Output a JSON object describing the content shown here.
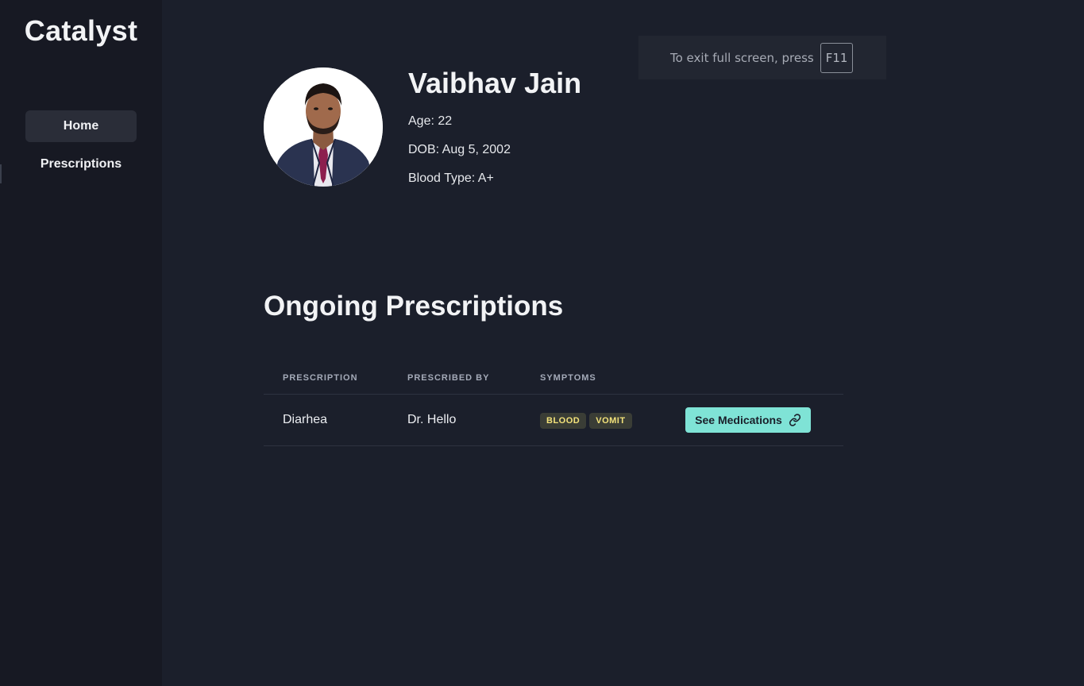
{
  "sidebar": {
    "brand": "Catalyst",
    "items": [
      {
        "label": "Home"
      },
      {
        "label": "Prescriptions"
      }
    ]
  },
  "fullscreen_notice": {
    "text": "To exit full screen, press",
    "key": "F11"
  },
  "patient": {
    "name": "Vaibhav Jain",
    "age": "Age: 22",
    "dob": "DOB: Aug 5, 2002",
    "blood_type": "Blood Type: A+"
  },
  "prescriptions": {
    "title": "Ongoing Prescriptions",
    "columns": [
      "PRESCRIPTION",
      "PRESCRIBED BY",
      "SYMPTOMS"
    ],
    "rows": [
      {
        "prescription": "Diarhea",
        "prescribed_by": "Dr. Hello",
        "symptoms": [
          "BLOOD",
          "VOMIT"
        ],
        "action_label": "See Medications",
        "action_icon": "link-icon"
      }
    ]
  },
  "colors": {
    "background": "#1b1f2b",
    "sidebar": "#171923",
    "accent": "#7fe3d6",
    "tag_text": "#f3e27a"
  }
}
